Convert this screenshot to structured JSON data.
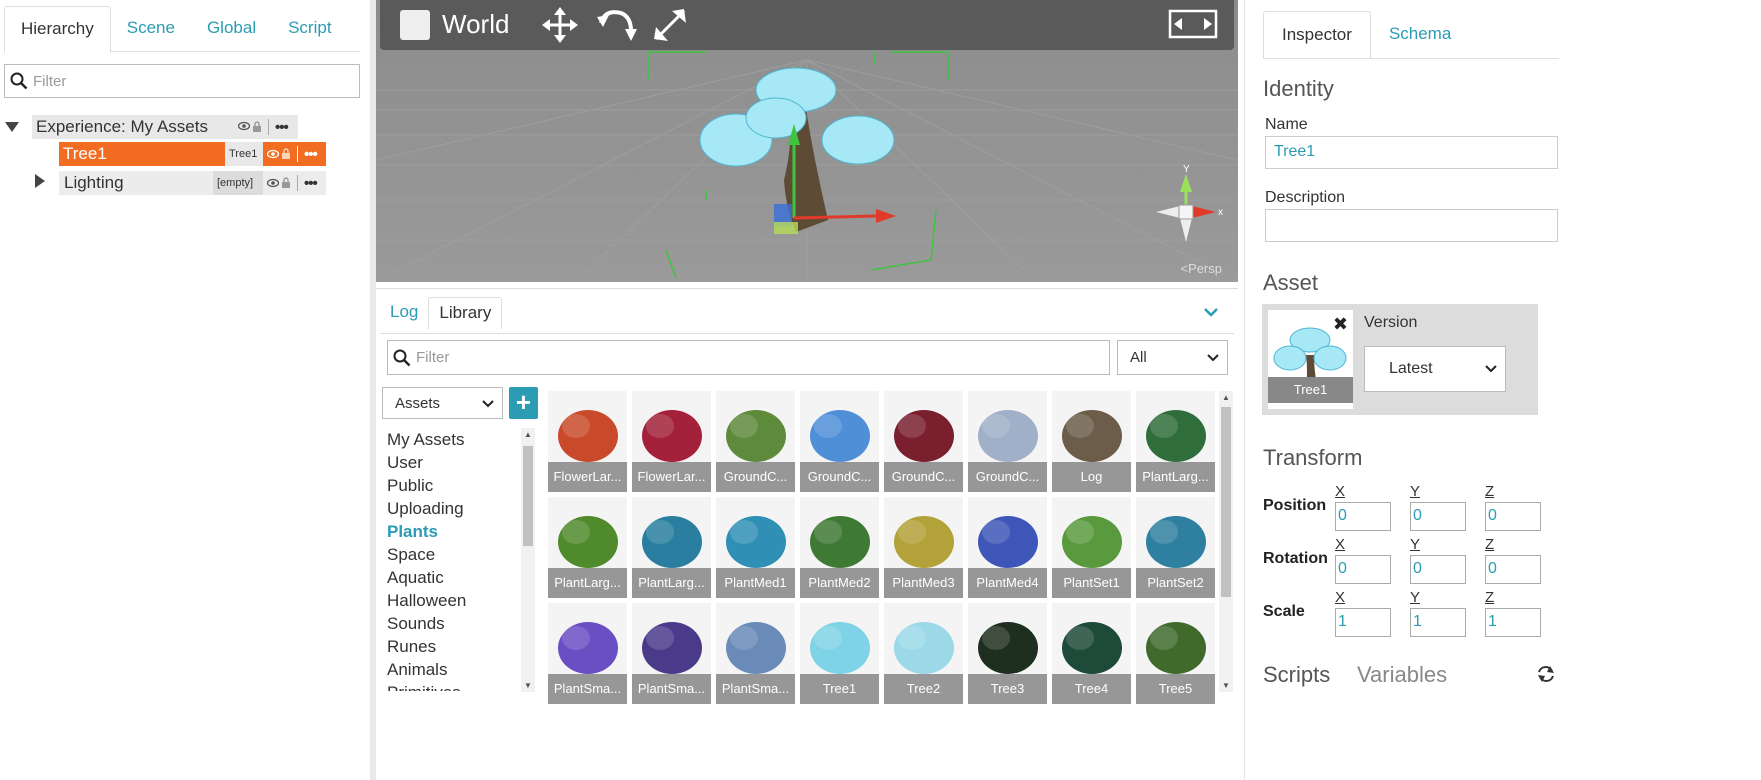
{
  "left_panel": {
    "tabs": [
      {
        "label": "Hierarchy",
        "active": true
      },
      {
        "label": "Scene",
        "active": false
      },
      {
        "label": "Global",
        "active": false
      },
      {
        "label": "Script",
        "active": false
      }
    ],
    "filter_placeholder": "Filter",
    "tree": {
      "root_label": "Experience: My Assets",
      "children": [
        {
          "label": "Tree1",
          "badge": "Tree1",
          "selected": true
        },
        {
          "label": "Lighting",
          "badge": "[empty]",
          "selected": false
        }
      ]
    }
  },
  "viewport": {
    "title": "World",
    "view_label": "Persp",
    "gizmo_x_label": "x",
    "gizmo_y_label": "Y"
  },
  "library": {
    "tabs": [
      {
        "label": "Log",
        "active": false
      },
      {
        "label": "Library",
        "active": true
      }
    ],
    "filter_placeholder": "Filter",
    "type_filter_selected": "All",
    "source_selected": "Assets",
    "categories": [
      "My Assets",
      "User",
      "Public",
      "Uploading",
      "Plants",
      "Space",
      "Aquatic",
      "Halloween",
      "Sounds",
      "Runes",
      "Animals",
      "Primitives"
    ],
    "active_category": "Plants",
    "assets": [
      {
        "label": "FlowerLar...",
        "color": "#c94a2a"
      },
      {
        "label": "FlowerLar...",
        "color": "#a3213a"
      },
      {
        "label": "GroundC...",
        "color": "#5e8a3c"
      },
      {
        "label": "GroundC...",
        "color": "#4f8fd8"
      },
      {
        "label": "GroundC...",
        "color": "#7a1f2e"
      },
      {
        "label": "GroundC...",
        "color": "#9fb0c8"
      },
      {
        "label": "Log",
        "color": "#6b5d4a"
      },
      {
        "label": "PlantLarg...",
        "color": "#2f6e3a"
      },
      {
        "label": "PlantLarg...",
        "color": "#4f8a2c"
      },
      {
        "label": "PlantLarg...",
        "color": "#2a7fa0"
      },
      {
        "label": "PlantMed1",
        "color": "#2f8fb5"
      },
      {
        "label": "PlantMed2",
        "color": "#3f7a34"
      },
      {
        "label": "PlantMed3",
        "color": "#b3a23a"
      },
      {
        "label": "PlantMed4",
        "color": "#3d56b8"
      },
      {
        "label": "PlantSet1",
        "color": "#5a9a3e"
      },
      {
        "label": "PlantSet2",
        "color": "#2f7fa0"
      },
      {
        "label": "PlantSma...",
        "color": "#6a4fc4"
      },
      {
        "label": "PlantSma...",
        "color": "#4a3a8a"
      },
      {
        "label": "PlantSma...",
        "color": "#6a8ab8"
      },
      {
        "label": "Tree1",
        "color": "#7fd3e6"
      },
      {
        "label": "Tree2",
        "color": "#9bd9e8"
      },
      {
        "label": "Tree3",
        "color": "#1f2f1f"
      },
      {
        "label": "Tree4",
        "color": "#1e4a3a"
      },
      {
        "label": "Tree5",
        "color": "#3f6a2c"
      }
    ]
  },
  "inspector": {
    "tabs": [
      {
        "label": "Inspector",
        "active": true
      },
      {
        "label": "Schema",
        "active": false
      }
    ],
    "identity_heading": "Identity",
    "name_label": "Name",
    "name_value": "Tree1",
    "description_label": "Description",
    "description_value": "",
    "asset_heading": "Asset",
    "asset_name": "Tree1",
    "version_label": "Version",
    "version_value": "Latest",
    "transform_heading": "Transform",
    "rows": [
      {
        "label": "Position",
        "x": "0",
        "y": "0",
        "z": "0"
      },
      {
        "label": "Rotation",
        "x": "0",
        "y": "0",
        "z": "0"
      },
      {
        "label": "Scale",
        "x": "1",
        "y": "1",
        "z": "1"
      }
    ],
    "axis_labels": [
      "X",
      "Y",
      "Z"
    ],
    "scripts_tab": "Scripts",
    "variables_tab": "Variables"
  },
  "colors": {
    "accent": "#2b9cb3",
    "selection": "#f26d22",
    "toolbar": "#5a5a5a"
  }
}
